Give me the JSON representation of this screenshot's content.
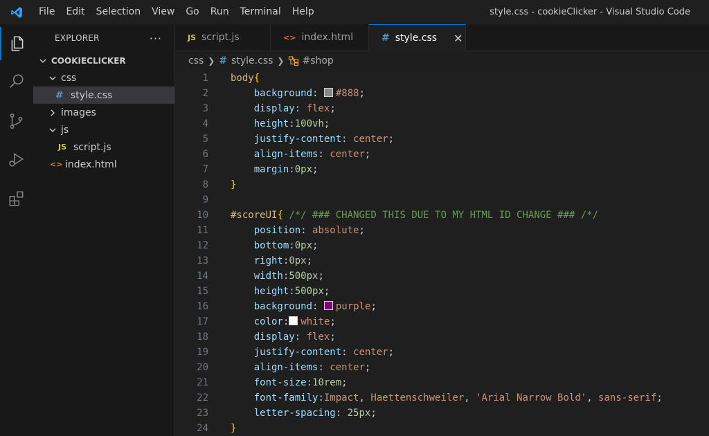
{
  "titlebar": {
    "menu": [
      "File",
      "Edit",
      "Selection",
      "View",
      "Go",
      "Run",
      "Terminal",
      "Help"
    ],
    "window_title": "style.css - cookieClicker - Visual Studio Code"
  },
  "activitybar": {
    "icons": [
      "explorer-icon",
      "search-icon",
      "source-control-icon",
      "run-debug-icon",
      "extensions-icon"
    ]
  },
  "sidebar": {
    "title": "EXPLORER",
    "more": "···",
    "tree": [
      {
        "label": "COOKIECLICKER",
        "type": "root",
        "expanded": true
      },
      {
        "label": "css",
        "type": "folder",
        "expanded": true
      },
      {
        "label": "style.css",
        "type": "css",
        "icon": "#",
        "selected": true
      },
      {
        "label": "images",
        "type": "folder",
        "expanded": false
      },
      {
        "label": "js",
        "type": "folder",
        "expanded": true
      },
      {
        "label": "script.js",
        "type": "js",
        "icon": "JS"
      },
      {
        "label": "index.html",
        "type": "html",
        "icon": "<>"
      }
    ]
  },
  "tabs": [
    {
      "label": "script.js",
      "icon": "JS",
      "active": false
    },
    {
      "label": "index.html",
      "icon": "<>",
      "active": false
    },
    {
      "label": "style.css",
      "icon": "#",
      "active": true,
      "close": "✕"
    }
  ],
  "breadcrumb": {
    "folder": "css",
    "file_icon": "#",
    "file": "style.css",
    "symbol": "#shop"
  },
  "colors": {
    "gray_swatch": "#888888",
    "purple_swatch": "#800080",
    "white_swatch": "#ffffff",
    "accent": "#0078d4"
  },
  "editor": {
    "lines": [
      {
        "n": "1",
        "tokens": [
          [
            "sel",
            "body"
          ],
          [
            "brace",
            "{"
          ]
        ]
      },
      {
        "n": "2",
        "tokens": [
          [
            "sp",
            "    "
          ],
          [
            "prop",
            "background"
          ],
          [
            "punc",
            ": "
          ],
          [
            "swatch",
            "gray_swatch"
          ],
          [
            "val",
            "#888"
          ],
          [
            "punc",
            ";"
          ]
        ]
      },
      {
        "n": "3",
        "tokens": [
          [
            "sp",
            "    "
          ],
          [
            "prop",
            "display"
          ],
          [
            "punc",
            ": "
          ],
          [
            "val",
            "flex"
          ],
          [
            "punc",
            ";"
          ]
        ]
      },
      {
        "n": "4",
        "tokens": [
          [
            "sp",
            "    "
          ],
          [
            "prop",
            "height"
          ],
          [
            "punc",
            ":"
          ],
          [
            "num",
            "100vh"
          ],
          [
            "punc",
            ";"
          ]
        ]
      },
      {
        "n": "5",
        "tokens": [
          [
            "sp",
            "    "
          ],
          [
            "prop",
            "justify-content"
          ],
          [
            "punc",
            ": "
          ],
          [
            "val",
            "center"
          ],
          [
            "punc",
            ";"
          ]
        ]
      },
      {
        "n": "6",
        "tokens": [
          [
            "sp",
            "    "
          ],
          [
            "prop",
            "align-items"
          ],
          [
            "punc",
            ": "
          ],
          [
            "val",
            "center"
          ],
          [
            "punc",
            ";"
          ]
        ]
      },
      {
        "n": "7",
        "tokens": [
          [
            "sp",
            "    "
          ],
          [
            "prop",
            "margin"
          ],
          [
            "punc",
            ":"
          ],
          [
            "num",
            "0px"
          ],
          [
            "punc",
            ";"
          ]
        ]
      },
      {
        "n": "8",
        "tokens": [
          [
            "brace",
            "}"
          ]
        ]
      },
      {
        "n": "9",
        "tokens": []
      },
      {
        "n": "10",
        "tokens": [
          [
            "sel",
            "#scoreUI"
          ],
          [
            "brace",
            "{"
          ],
          [
            "punc",
            " "
          ],
          [
            "comment",
            "/*/ ### CHANGED THIS DUE TO MY HTML ID CHANGE ### /*/"
          ]
        ]
      },
      {
        "n": "11",
        "tokens": [
          [
            "sp",
            "    "
          ],
          [
            "prop",
            "position"
          ],
          [
            "punc",
            ": "
          ],
          [
            "val",
            "absolute"
          ],
          [
            "punc",
            ";"
          ]
        ]
      },
      {
        "n": "12",
        "tokens": [
          [
            "sp",
            "    "
          ],
          [
            "prop",
            "bottom"
          ],
          [
            "punc",
            ":"
          ],
          [
            "num",
            "0px"
          ],
          [
            "punc",
            ";"
          ]
        ]
      },
      {
        "n": "13",
        "tokens": [
          [
            "sp",
            "    "
          ],
          [
            "prop",
            "right"
          ],
          [
            "punc",
            ":"
          ],
          [
            "num",
            "0px"
          ],
          [
            "punc",
            ";"
          ]
        ]
      },
      {
        "n": "14",
        "tokens": [
          [
            "sp",
            "    "
          ],
          [
            "prop",
            "width"
          ],
          [
            "punc",
            ":"
          ],
          [
            "num",
            "500px"
          ],
          [
            "punc",
            ";"
          ]
        ]
      },
      {
        "n": "15",
        "tokens": [
          [
            "sp",
            "    "
          ],
          [
            "prop",
            "height"
          ],
          [
            "punc",
            ":"
          ],
          [
            "num",
            "500px"
          ],
          [
            "punc",
            ";"
          ]
        ]
      },
      {
        "n": "16",
        "tokens": [
          [
            "sp",
            "    "
          ],
          [
            "prop",
            "background"
          ],
          [
            "punc",
            ": "
          ],
          [
            "swatch",
            "purple_swatch"
          ],
          [
            "val",
            "purple"
          ],
          [
            "punc",
            ";"
          ]
        ]
      },
      {
        "n": "17",
        "tokens": [
          [
            "sp",
            "    "
          ],
          [
            "prop",
            "color"
          ],
          [
            "punc",
            ":"
          ],
          [
            "swatch",
            "white_swatch"
          ],
          [
            "val",
            "white"
          ],
          [
            "punc",
            ";"
          ]
        ]
      },
      {
        "n": "18",
        "tokens": [
          [
            "sp",
            "    "
          ],
          [
            "prop",
            "display"
          ],
          [
            "punc",
            ": "
          ],
          [
            "val",
            "flex"
          ],
          [
            "punc",
            ";"
          ]
        ]
      },
      {
        "n": "19",
        "tokens": [
          [
            "sp",
            "    "
          ],
          [
            "prop",
            "justify-content"
          ],
          [
            "punc",
            ": "
          ],
          [
            "val",
            "center"
          ],
          [
            "punc",
            ";"
          ]
        ]
      },
      {
        "n": "20",
        "tokens": [
          [
            "sp",
            "    "
          ],
          [
            "prop",
            "align-items"
          ],
          [
            "punc",
            ": "
          ],
          [
            "val",
            "center"
          ],
          [
            "punc",
            ";"
          ]
        ]
      },
      {
        "n": "21",
        "tokens": [
          [
            "sp",
            "    "
          ],
          [
            "prop",
            "font-size"
          ],
          [
            "punc",
            ":"
          ],
          [
            "num",
            "10rem"
          ],
          [
            "punc",
            ";"
          ]
        ]
      },
      {
        "n": "22",
        "tokens": [
          [
            "sp",
            "    "
          ],
          [
            "prop",
            "font-family"
          ],
          [
            "punc",
            ":"
          ],
          [
            "val",
            "Impact"
          ],
          [
            "punc",
            ", "
          ],
          [
            "val",
            "Haettenschweiler"
          ],
          [
            "punc",
            ", "
          ],
          [
            "val",
            "'Arial Narrow Bold'"
          ],
          [
            "punc",
            ", "
          ],
          [
            "val",
            "sans-serif"
          ],
          [
            "punc",
            ";"
          ]
        ]
      },
      {
        "n": "23",
        "tokens": [
          [
            "sp",
            "    "
          ],
          [
            "prop",
            "letter-spacing"
          ],
          [
            "punc",
            ": "
          ],
          [
            "num",
            "25px"
          ],
          [
            "punc",
            ";"
          ]
        ]
      },
      {
        "n": "24",
        "tokens": [
          [
            "brace",
            "}"
          ]
        ]
      }
    ]
  }
}
